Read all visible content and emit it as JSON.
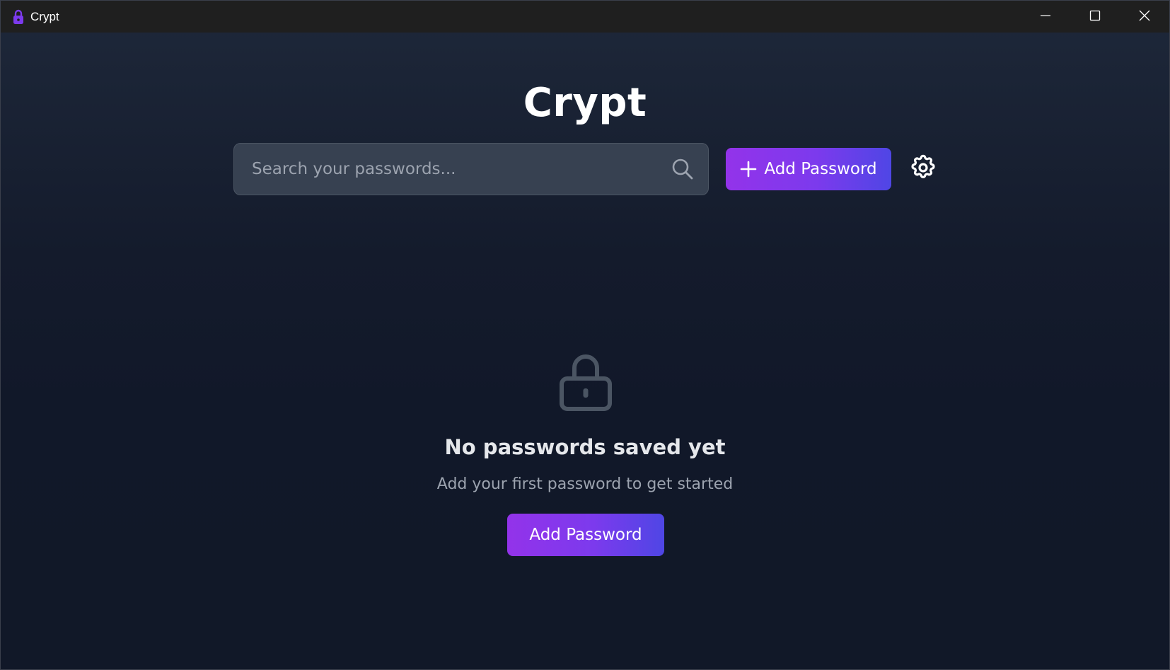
{
  "window": {
    "title": "Crypt",
    "icon": "lock-icon",
    "controls": [
      "minimize-icon",
      "maximize-icon",
      "close-icon"
    ]
  },
  "header": {
    "title": "Crypt"
  },
  "search": {
    "placeholder": "Search your passwords...",
    "value": "",
    "icon": "search-icon"
  },
  "toolbar": {
    "add_label": "Add Password",
    "add_icon": "plus-icon",
    "settings_icon": "gear-icon"
  },
  "empty_state": {
    "icon": "lock-icon",
    "title": "No passwords saved yet",
    "subtitle": "Add your first password to get started",
    "button_label": "Add Password"
  },
  "colors": {
    "accent_start": "#9333ea",
    "accent_end": "#4f46e5",
    "background": "#111828",
    "titlebar": "#1f1f1f",
    "input_bg": "#374151"
  }
}
